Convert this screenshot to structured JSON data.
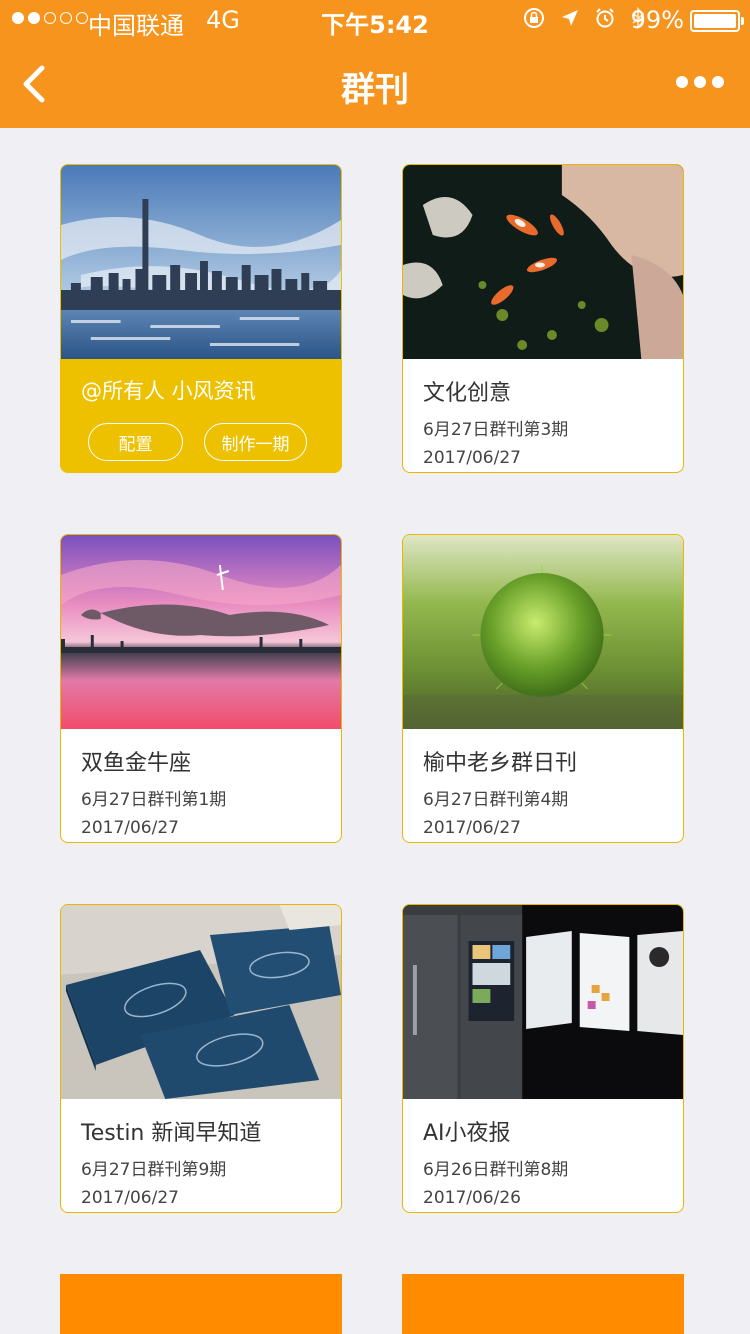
{
  "status_bar": {
    "carrier": "中国联通",
    "network": "4G",
    "time": "下午5:42",
    "battery": "99%",
    "signal_dots_filled": 2,
    "signal_dots_total": 5
  },
  "nav": {
    "title": "群刊"
  },
  "featured": {
    "title": "@所有人 小风资讯",
    "config_label": "配置",
    "make_label": "制作一期"
  },
  "cards": [
    {
      "title": "文化创意",
      "subtitle": "6月27日群刊第3期",
      "date": "2017/06/27"
    },
    {
      "title": "双鱼金牛座",
      "subtitle": "6月27日群刊第1期",
      "date": "2017/06/27"
    },
    {
      "title": "榆中老乡群日刊",
      "subtitle": "6月27日群刊第4期",
      "date": "2017/06/27"
    },
    {
      "title": "Testin 新闻早知道",
      "subtitle": "6月27日群刊第9期",
      "date": "2017/06/27"
    },
    {
      "title": "AI小夜报",
      "subtitle": "6月26日群刊第8期",
      "date": "2017/06/26"
    }
  ],
  "colors": {
    "accent": "#f7941d",
    "featured_card": "#eec100",
    "card_border": "#e8b800"
  }
}
